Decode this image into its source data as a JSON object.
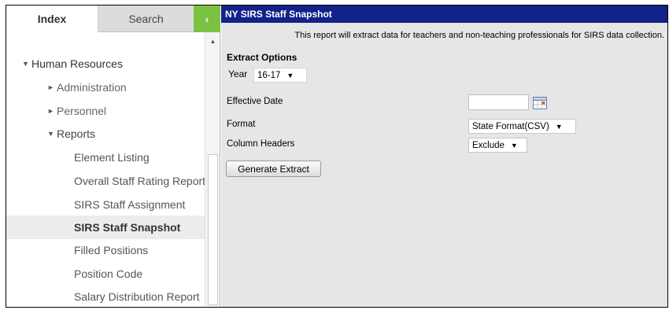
{
  "tabs": {
    "index": "Index",
    "search": "Search"
  },
  "collapse_glyph": "‹",
  "tree": {
    "root": {
      "label": "Human Resources",
      "expanded": true
    },
    "items": [
      {
        "label": "Administration",
        "expanded": false
      },
      {
        "label": "Personnel",
        "expanded": false
      },
      {
        "label": "Reports",
        "expanded": true
      }
    ],
    "reports": [
      {
        "label": "Element Listing",
        "selected": false
      },
      {
        "label": "Overall Staff Rating Report",
        "selected": false
      },
      {
        "label": "SIRS Staff Assignment",
        "selected": false
      },
      {
        "label": "SIRS Staff Snapshot",
        "selected": true
      },
      {
        "label": "Filled Positions",
        "selected": false
      },
      {
        "label": "Position Code",
        "selected": false
      },
      {
        "label": "Salary Distribution Report",
        "selected": false
      }
    ]
  },
  "report": {
    "title": "NY SIRS Staff Snapshot",
    "description": "This report will extract data for teachers and non-teaching professionals for SIRS data collection.",
    "section_title": "Extract Options",
    "year": {
      "label": "Year",
      "value": "16-17"
    },
    "effective_date": {
      "label": "Effective Date",
      "value": ""
    },
    "format": {
      "label": "Format",
      "value": "State Format(CSV)"
    },
    "column_headers": {
      "label": "Column Headers",
      "value": "Exclude"
    },
    "generate_button": "Generate Extract"
  },
  "colors": {
    "title_bar": "#13218a",
    "collapse_button": "#7cc242",
    "content_background": "#e6e6e6",
    "selected_item": "#ececec"
  },
  "icons": {
    "collapse": "chevron-left-icon",
    "calendar": "calendar-icon",
    "tree_expanded": "triangle-down-icon",
    "tree_collapsed": "triangle-right-icon",
    "dropdown": "caret-down-icon"
  }
}
